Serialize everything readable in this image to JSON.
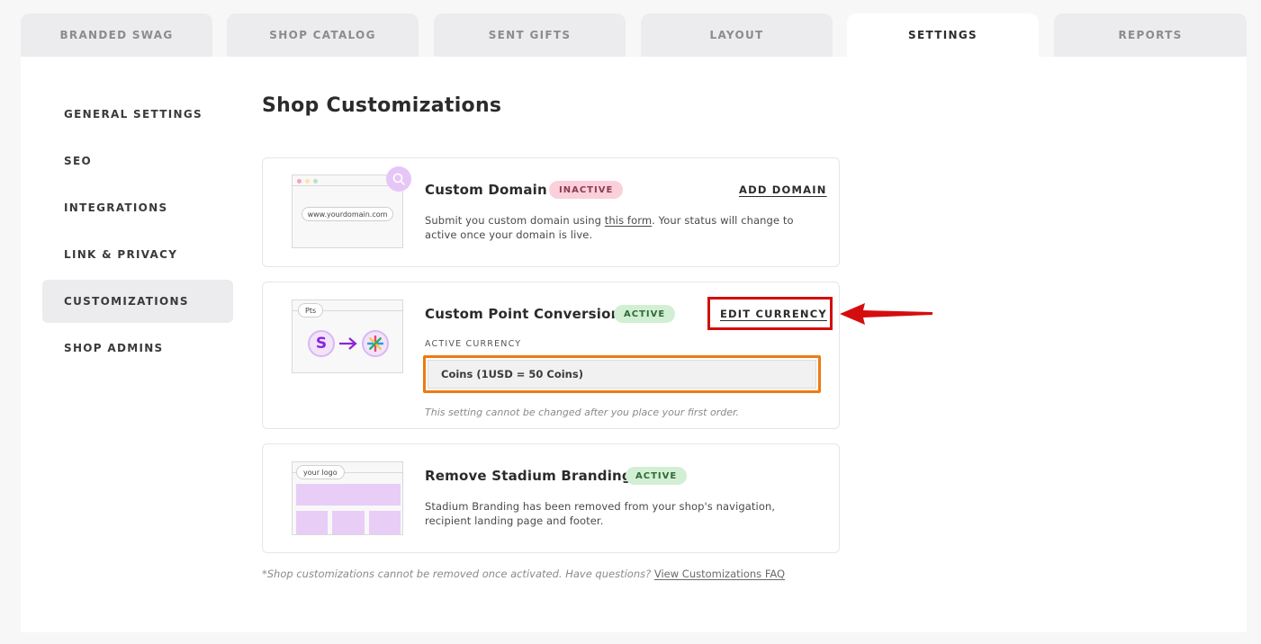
{
  "tabs": [
    {
      "label": "BRANDED SWAG"
    },
    {
      "label": "SHOP CATALOG"
    },
    {
      "label": "SENT GIFTS"
    },
    {
      "label": "LAYOUT"
    },
    {
      "label": "SETTINGS"
    },
    {
      "label": "REPORTS"
    }
  ],
  "sidebar": {
    "items": [
      {
        "label": "GENERAL SETTINGS"
      },
      {
        "label": "SEO"
      },
      {
        "label": "INTEGRATIONS"
      },
      {
        "label": "LINK & PRIVACY"
      },
      {
        "label": "CUSTOMIZATIONS"
      },
      {
        "label": "SHOP ADMINS"
      }
    ]
  },
  "page": {
    "title": "Shop Customizations"
  },
  "custom_domain": {
    "title": "Custom Domain",
    "status": "INACTIVE",
    "action": "ADD DOMAIN",
    "desc_before": "Submit you custom domain using ",
    "desc_link": "this form",
    "desc_after": ". Your status will change to active once your domain is live.",
    "illus_url": "www.yourdomain.com"
  },
  "point_conversion": {
    "title": "Custom Point Conversion",
    "status": "ACTIVE",
    "action": "EDIT CURRENCY",
    "field_label": "ACTIVE CURRENCY",
    "currency_value": "Coins (1USD = 50 Coins)",
    "hint": "This setting cannot be changed after you place your first order.",
    "illus_tag": "Pts",
    "illus_letter": "S"
  },
  "branding": {
    "title": "Remove Stadium Branding",
    "status": "ACTIVE",
    "desc": "Stadium Branding has been removed from your shop's navigation, recipient landing page and footer.",
    "illus_tag": "your logo"
  },
  "footer": {
    "note": "*Shop customizations cannot be removed once activated. Have questions?",
    "link": "View Customizations FAQ"
  },
  "colors": {
    "highlight_orange": "#ee7a12",
    "highlight_red": "#d40e0e",
    "accent_purple": "#8b24d9"
  }
}
